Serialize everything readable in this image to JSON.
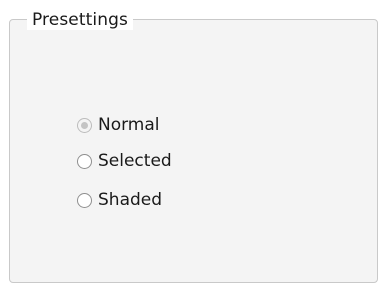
{
  "group": {
    "title": "Presettings"
  },
  "options": [
    {
      "label": "Normal",
      "selected": true,
      "enabled": false
    },
    {
      "label": "Selected",
      "selected": false,
      "enabled": true
    },
    {
      "label": "Shaded",
      "selected": false,
      "enabled": true
    }
  ]
}
